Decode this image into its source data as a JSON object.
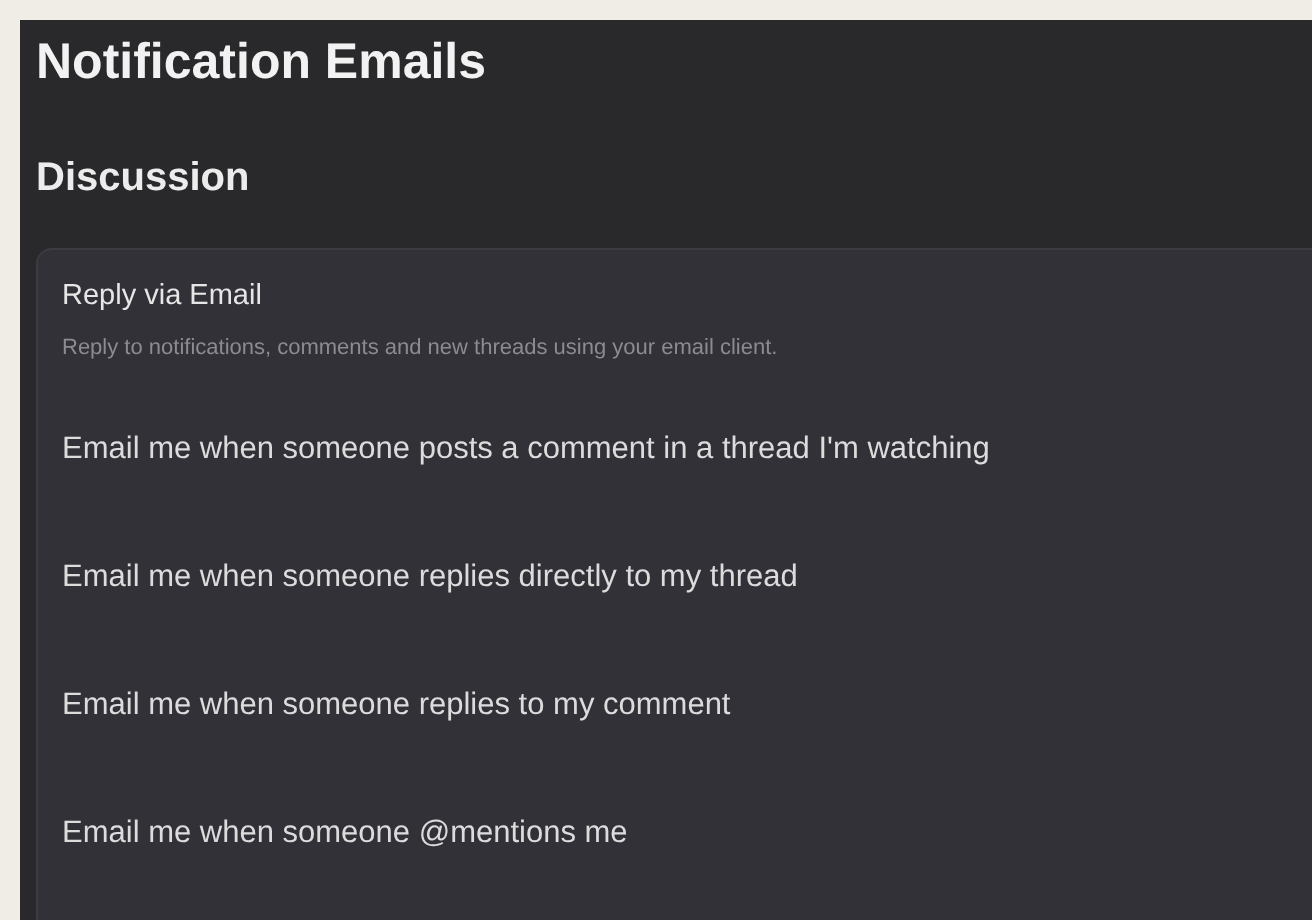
{
  "title": "Notification Emails",
  "section": {
    "heading": "Discussion",
    "card": {
      "title": "Reply via Email",
      "description": "Reply to notifications, comments and new threads using your email client.",
      "options": [
        {
          "label": "Email me when someone posts a comment in a thread I'm watching"
        },
        {
          "label": "Email me when someone replies directly to my thread"
        },
        {
          "label": "Email me when someone replies to my comment"
        },
        {
          "label": "Email me when someone @mentions me"
        }
      ]
    }
  }
}
